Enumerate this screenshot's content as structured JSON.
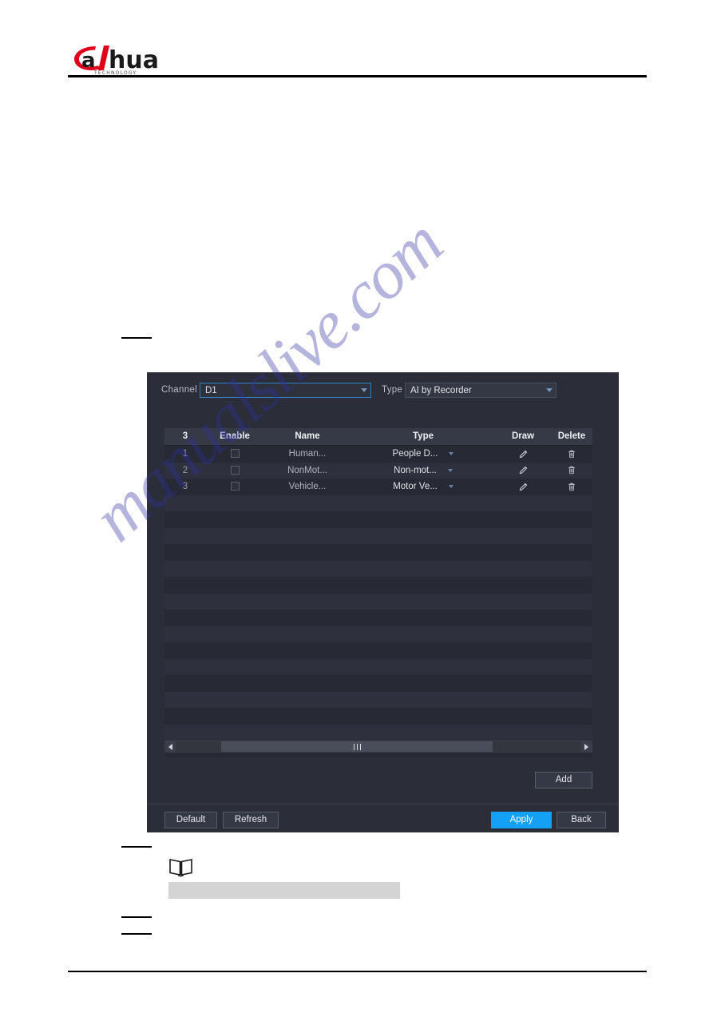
{
  "brand": {
    "name": "alhua",
    "wordmark": "alhua",
    "tagline": "TECHNOLOGY"
  },
  "watermark": {
    "text": "manualslive.com"
  },
  "dialog": {
    "filters": {
      "channel_label": "Channel",
      "channel_value": "D1",
      "type_label": "Type",
      "type_value": "AI by Recorder"
    },
    "table": {
      "headers": {
        "index": "3",
        "enable": "Enable",
        "name": "Name",
        "type": "Type",
        "draw": "Draw",
        "delete": "Delete"
      },
      "rows": [
        {
          "index": "1",
          "enabled": false,
          "name": "Human...",
          "type": "People D..."
        },
        {
          "index": "2",
          "enabled": false,
          "name": "NonMot...",
          "type": "Non-mot..."
        },
        {
          "index": "3",
          "enabled": false,
          "name": "Vehicle...",
          "type": "Motor Ve..."
        }
      ],
      "empty_row_count": 16
    },
    "scrollbar": {
      "left_arrow": "scroll-left",
      "right_arrow": "scroll-right",
      "thumb_position_percent": 34
    },
    "buttons": {
      "add": "Add",
      "default": "Default",
      "refresh": "Refresh",
      "apply": "Apply",
      "back": "Back"
    }
  },
  "colors": {
    "dialog_bg": "#2b2e39",
    "header_row_bg": "#363a47",
    "accent_blue": "#14a0f5",
    "focus_border": "#2f82c9",
    "logo_red": "#e1001a",
    "text_primary": "#e2e4ea",
    "text_muted": "#a9adb8"
  }
}
